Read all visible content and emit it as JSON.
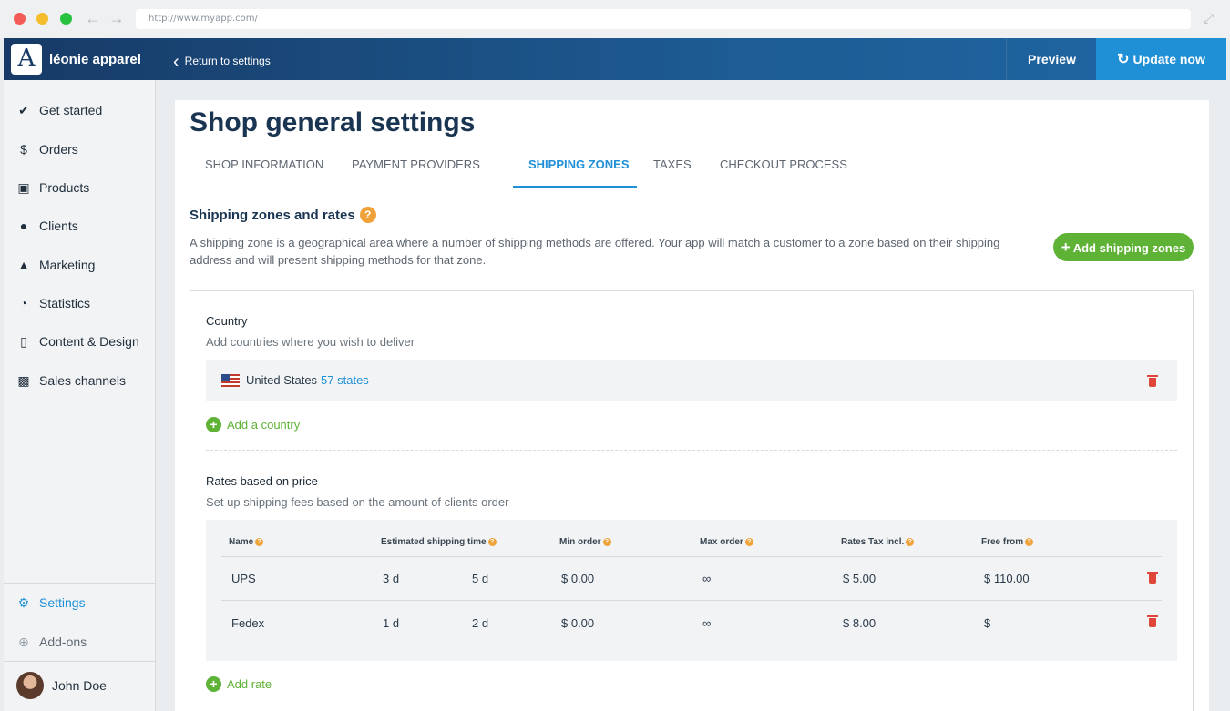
{
  "browser": {
    "url": "http://www.myapp.com/"
  },
  "topbar": {
    "logo_letter": "A",
    "brand": "léonie apparel",
    "return_label": "Return to settings",
    "preview_label": "Preview",
    "update_label": "Update now"
  },
  "sidebar": {
    "items": [
      {
        "label": "Get started",
        "icon": "check-circle-icon"
      },
      {
        "label": "Orders",
        "icon": "dollar-circle-icon"
      },
      {
        "label": "Products",
        "icon": "cart-icon"
      },
      {
        "label": "Clients",
        "icon": "people-icon"
      },
      {
        "label": "Marketing",
        "icon": "bell-icon"
      },
      {
        "label": "Statistics",
        "icon": "pie-chart-icon"
      },
      {
        "label": "Content & Design",
        "icon": "phone-icon"
      },
      {
        "label": "Sales channels",
        "icon": "store-icon"
      }
    ],
    "settings_label": "Settings",
    "addons_label": "Add-ons",
    "user_name": "John Doe"
  },
  "page": {
    "title": "Shop general settings",
    "tabs": [
      "SHOP INFORMATION",
      "PAYMENT PROVIDERS",
      "SHIPPING ZONES",
      "TAXES",
      "CHECKOUT PROCESS"
    ],
    "active_tab": "SHIPPING ZONES",
    "section_title": "Shipping zones and rates",
    "section_help": "?",
    "section_desc": "A shipping zone is a geographical area where a number of shipping methods are offered. Your app will match a customer to a zone based on their shipping address and will present shipping methods for that zone.",
    "add_zone_label": "Add shipping zones"
  },
  "country": {
    "title": "Country",
    "subtitle": "Add countries where you wish to deliver",
    "name": "United States",
    "states_link": "57 states",
    "add_label": "Add a country"
  },
  "rates": {
    "title": "Rates based on price",
    "subtitle": "Set up shipping fees based on the amount of clients order",
    "columns": [
      "Name",
      "Estimated shipping time",
      "Min order",
      "Max order",
      "Rates Tax incl.",
      "Free from"
    ],
    "rows": [
      {
        "name": "UPS",
        "time_min": "3 d",
        "time_max": "5 d",
        "min_order": "$ 0.00",
        "max_order": "∞",
        "rate": "$ 5.00",
        "free_from": "$ 110.00"
      },
      {
        "name": "Fedex",
        "time_min": "1 d",
        "time_max": "2 d",
        "min_order": "$ 0.00",
        "max_order": "∞",
        "rate": "$ 8.00",
        "free_from": "$"
      }
    ],
    "add_label": "Add rate"
  },
  "colors": {
    "accent": "#1f8fd6",
    "success": "#5eb236",
    "danger": "#e0453a",
    "help": "#f0a23a"
  }
}
